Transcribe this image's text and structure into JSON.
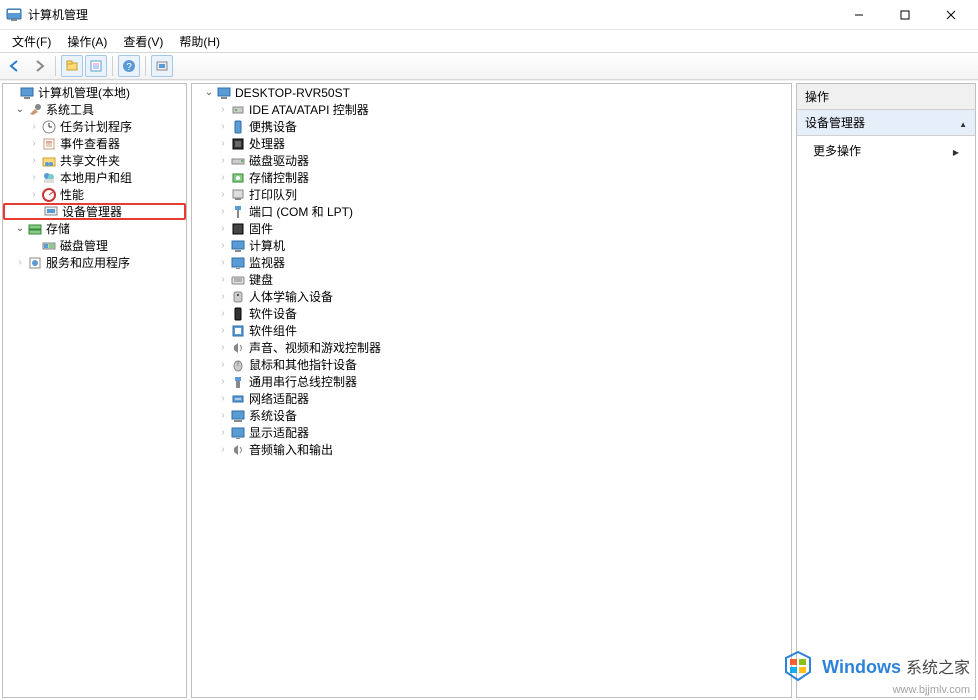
{
  "window": {
    "title": "计算机管理"
  },
  "menu": {
    "file": "文件(F)",
    "action": "操作(A)",
    "view": "查看(V)",
    "help": "帮助(H)"
  },
  "leftTree": {
    "root": "计算机管理(本地)",
    "sysTools": "系统工具",
    "taskScheduler": "任务计划程序",
    "eventViewer": "事件查看器",
    "sharedFolders": "共享文件夹",
    "localUsers": "本地用户和组",
    "performance": "性能",
    "deviceManager": "设备管理器",
    "storage": "存储",
    "diskMgmt": "磁盘管理",
    "services": "服务和应用程序"
  },
  "midTree": {
    "root": "DESKTOP-RVR50ST",
    "items": [
      "IDE ATA/ATAPI 控制器",
      "便携设备",
      "处理器",
      "磁盘驱动器",
      "存储控制器",
      "打印队列",
      "端口 (COM 和 LPT)",
      "固件",
      "计算机",
      "监视器",
      "键盘",
      "人体学输入设备",
      "软件设备",
      "软件组件",
      "声音、视频和游戏控制器",
      "鼠标和其他指针设备",
      "通用串行总线控制器",
      "网络适配器",
      "系统设备",
      "显示适配器",
      "音频输入和输出"
    ]
  },
  "rightPanel": {
    "header": "操作",
    "section": "设备管理器",
    "more": "更多操作"
  },
  "watermark": {
    "brand": "Windows",
    "suffix": "系统之家",
    "url": "www.bjjmlv.com"
  }
}
